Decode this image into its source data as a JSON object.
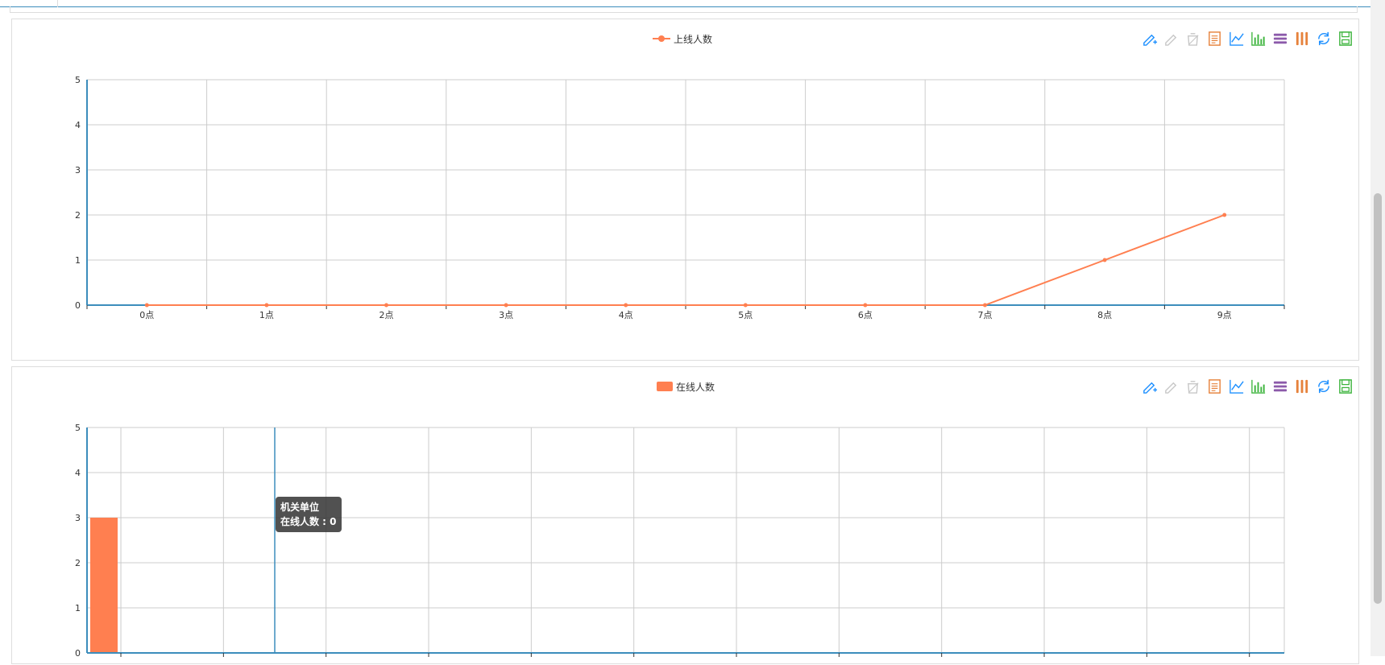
{
  "colors": {
    "series": "#ff7f50",
    "axis": "#3c8dbc",
    "grid": "#cccccc",
    "tool_blue": "#1e90ff",
    "tool_gray": "#c8c8c8",
    "tool_orange": "#e6823c",
    "tool_green": "#3cb43c",
    "tool_purple": "#8c5aaa"
  },
  "chart1": {
    "title": "",
    "legend_label": "上线人数",
    "toolbox_icons": [
      "mark-icon",
      "mark-undo-icon",
      "mark-clear-icon",
      "data-view-icon",
      "line-chart-icon",
      "bar-chart-icon",
      "stack-icon",
      "tiled-icon",
      "restore-icon",
      "save-image-icon"
    ]
  },
  "chart2": {
    "title": "",
    "legend_label": "在线人数",
    "tooltip": {
      "category": "机关单位",
      "series_line": "在线人数 : 0"
    },
    "toolbox_icons": [
      "mark-icon",
      "mark-undo-icon",
      "mark-clear-icon",
      "data-view-icon",
      "line-chart-icon",
      "bar-chart-icon",
      "stack-icon",
      "tiled-icon",
      "restore-icon",
      "save-image-icon"
    ]
  },
  "chart_data": [
    {
      "type": "line",
      "title": "",
      "x": [
        "0点",
        "1点",
        "2点",
        "3点",
        "4点",
        "5点",
        "6点",
        "7点",
        "8点",
        "9点"
      ],
      "series": [
        {
          "name": "上线人数",
          "values": [
            0,
            0,
            0,
            0,
            0,
            0,
            0,
            0,
            1,
            2
          ]
        }
      ],
      "ylim": [
        0,
        5
      ],
      "yticks": [
        0,
        1,
        2,
        3,
        4,
        5
      ],
      "grid": true,
      "legend": "top-center"
    },
    {
      "type": "bar",
      "title": "",
      "categories": [
        "",
        "",
        "",
        "",
        "",
        "",
        "",
        "",
        "",
        "",
        "",
        ""
      ],
      "series": [
        {
          "name": "在线人数",
          "values": [
            3,
            0,
            0,
            0,
            0,
            0,
            0,
            0,
            0,
            0,
            0,
            0
          ]
        }
      ],
      "ylim": [
        0,
        5
      ],
      "yticks": [
        0,
        1,
        2,
        3,
        4,
        5
      ],
      "grid": true,
      "legend": "top-center",
      "axis_pointer_category_index": 2
    }
  ]
}
